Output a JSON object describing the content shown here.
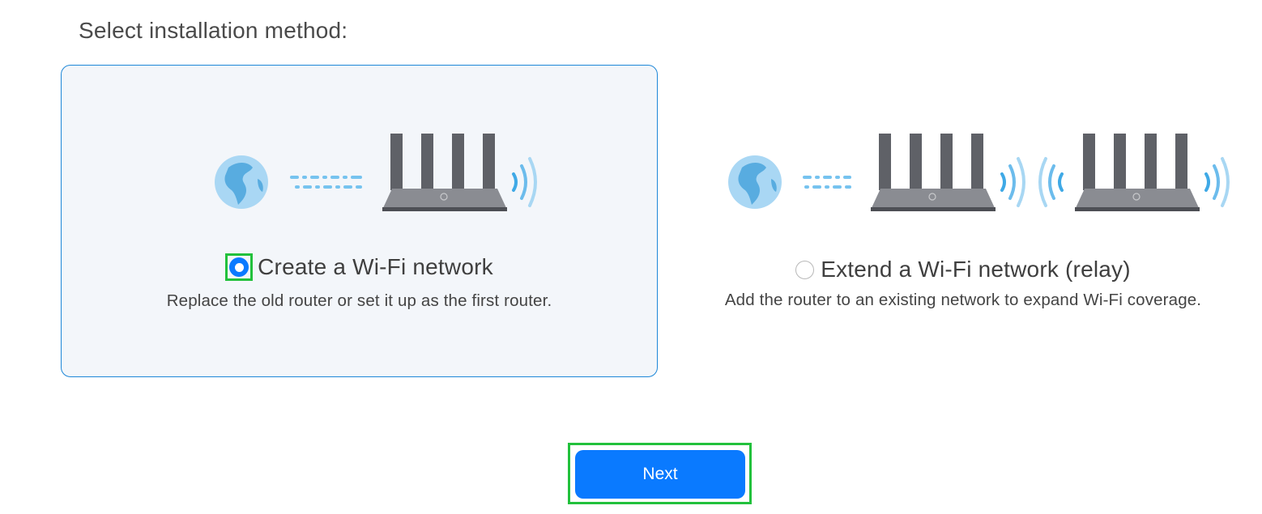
{
  "heading": "Select installation method:",
  "options": [
    {
      "title": "Create a Wi-Fi network",
      "description": "Replace the old router or set it up as the first router.",
      "selected": true
    },
    {
      "title": "Extend a Wi-Fi network (relay)",
      "description": "Add the router to an existing network to expand Wi-Fi coverage.",
      "selected": false
    }
  ],
  "next_button": {
    "label": "Next"
  },
  "colors": {
    "accent": "#0a7aff",
    "selected_card_border": "#1d87d8",
    "selected_card_background": "#f3f6fa",
    "highlight": "#22c13c",
    "router": "#5f6167",
    "globe": "#8ec7ec",
    "signal": "#5fb8ea"
  },
  "icons": {
    "globe": "globe-icon",
    "router": "router-icon",
    "wifi_signal": "wifi-signal-icon",
    "cable": "cable-dashes-icon"
  }
}
